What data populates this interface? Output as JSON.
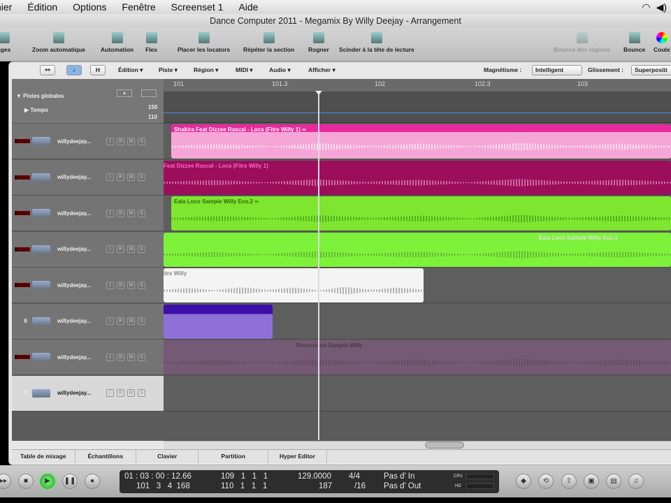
{
  "menubar": [
    "hier",
    "Édition",
    "Options",
    "Fenêtre",
    "Screenset 1",
    "Aide"
  ],
  "window_title": "Dance Computer 2011 - Megamix By Willy Deejay - Arrangement",
  "toolbar": {
    "items": [
      "ages",
      "Zoom automatique",
      "Automation",
      "Flex",
      "Placer les locators",
      "Répéter la section",
      "Rogner",
      "Scinder à la tête de lecture"
    ],
    "right": [
      "Bounce des régions",
      "Bounce",
      "Coule"
    ]
  },
  "arrange_bar": {
    "buttons": [
      "H"
    ],
    "menus": [
      "Édition ▾",
      "Piste ▾",
      "Région ▾",
      "MIDI ▾",
      "Audio ▾",
      "Afficher ▾"
    ],
    "snap_label": "Magnétisme :",
    "snap_value": "Intelligent",
    "drag_label": "Glissement :",
    "drag_value": "Superpositi"
  },
  "ruler": [
    "101",
    "101.3",
    "102",
    "102.3",
    "103"
  ],
  "globals": {
    "title": "▼ Pistes globales",
    "tempo": "▶ Tempo",
    "tempo_hi": "150",
    "tempo_lo": "110"
  },
  "tracks": [
    {
      "num": "",
      "name": "willydeejay...",
      "sel": false
    },
    {
      "num": "",
      "name": "willydeejay...",
      "sel": false
    },
    {
      "num": "",
      "name": "willydeejay...",
      "sel": false
    },
    {
      "num": "",
      "name": "willydeejay...",
      "sel": false
    },
    {
      "num": "",
      "name": "willydeejay...",
      "sel": false
    },
    {
      "num": "6",
      "name": "willydeejay...",
      "sel": false
    },
    {
      "num": "",
      "name": "willydeejay...",
      "sel": false
    },
    {
      "num": "8",
      "name": "willydeejay...",
      "sel": true
    }
  ],
  "track_buttons": [
    "I",
    "R",
    "M",
    "S"
  ],
  "regions": [
    {
      "title": "Shakira Feat Dizzee Rascal - Loca (Fitre Willy 1) ∞",
      "color": "#e92a9e"
    },
    {
      "title": "Feat Dizzee Rascal - Loca (Fitre Willy 1)",
      "color": "#9c0e5c"
    },
    {
      "title": "Eala Loco Sample Willy Eco.2 ∞",
      "color": "#7ee62e"
    },
    {
      "title": "Eala Loco Sample Willy Eco.1",
      "color": "#7ef23a"
    },
    {
      "title": "itre Willy",
      "color": "#f4f4f4"
    },
    {
      "title": "",
      "color": "#3c10a8"
    },
    {
      "title": "Percussion Sample Willy",
      "color": "#745a74"
    }
  ],
  "tabs": [
    "Table de mixage",
    "Échantillons",
    "Clavier",
    "Partition",
    "Hyper Editor"
  ],
  "transport": {
    "smpte": "01 : 03 : 00 : 12.66",
    "bars": "101   3   4  168",
    "left": "109   1   1   1",
    "right": "110   1   1   1",
    "tempo": "129.0000",
    "div": "187",
    "sig": "4/4",
    "sig2": "/16",
    "in": "Pas d' In",
    "out": "Pas d' Out",
    "cpu": "CPU",
    "hd": "HD"
  }
}
